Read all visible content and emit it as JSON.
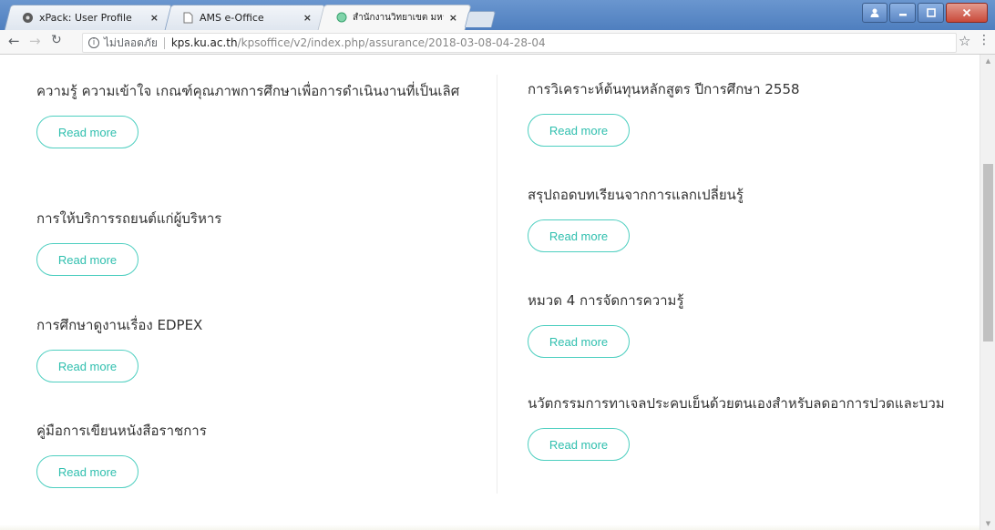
{
  "browser": {
    "tabs": [
      {
        "title": "xPack: User Profile",
        "icon": "gear-favicon",
        "active": false
      },
      {
        "title": "AMS e-Office",
        "icon": "page-favicon",
        "active": false
      },
      {
        "title": "สำนักงานวิทยาเขต มหาวิทยา",
        "icon": "globe-favicon",
        "active": true
      }
    ],
    "tab_close_label": "×",
    "address": {
      "security_label": "ไม่ปลอดภัย",
      "host": "kps.ku.ac.th",
      "path": "/kpsoffice/v2/index.php/assurance/2018-03-08-04-28-04"
    }
  },
  "articles": {
    "left": [
      {
        "title": "ความรู้ ความเข้าใจ เกณฑ์คุณภาพการศึกษาเพื่อการดำเนินงานที่เป็นเลิศ"
      },
      {
        "title": "การให้บริการรถยนต์แก่ผู้บริหาร"
      },
      {
        "title": "การศึกษาดูงานเรื่อง EDPEX"
      },
      {
        "title": "คู่มือการเขียนหนังสือราชการ"
      }
    ],
    "right": [
      {
        "title": "การวิเคราะห์ต้นทุนหลักสูตร ปีการศึกษา 2558"
      },
      {
        "title": "สรุปถอดบทเรียนจากการแลกเปลี่ยนรู้"
      },
      {
        "title": "หมวด 4 การจัดการความรู้"
      },
      {
        "title": "นวัตกรรมการทาเจลประคบเย็นด้วยตนเองสำหรับลดอาการปวดและบวม"
      }
    ],
    "read_more_label": "Read more"
  },
  "colors": {
    "accent": "#2fbfae",
    "accent_border": "#4ecfc0"
  }
}
